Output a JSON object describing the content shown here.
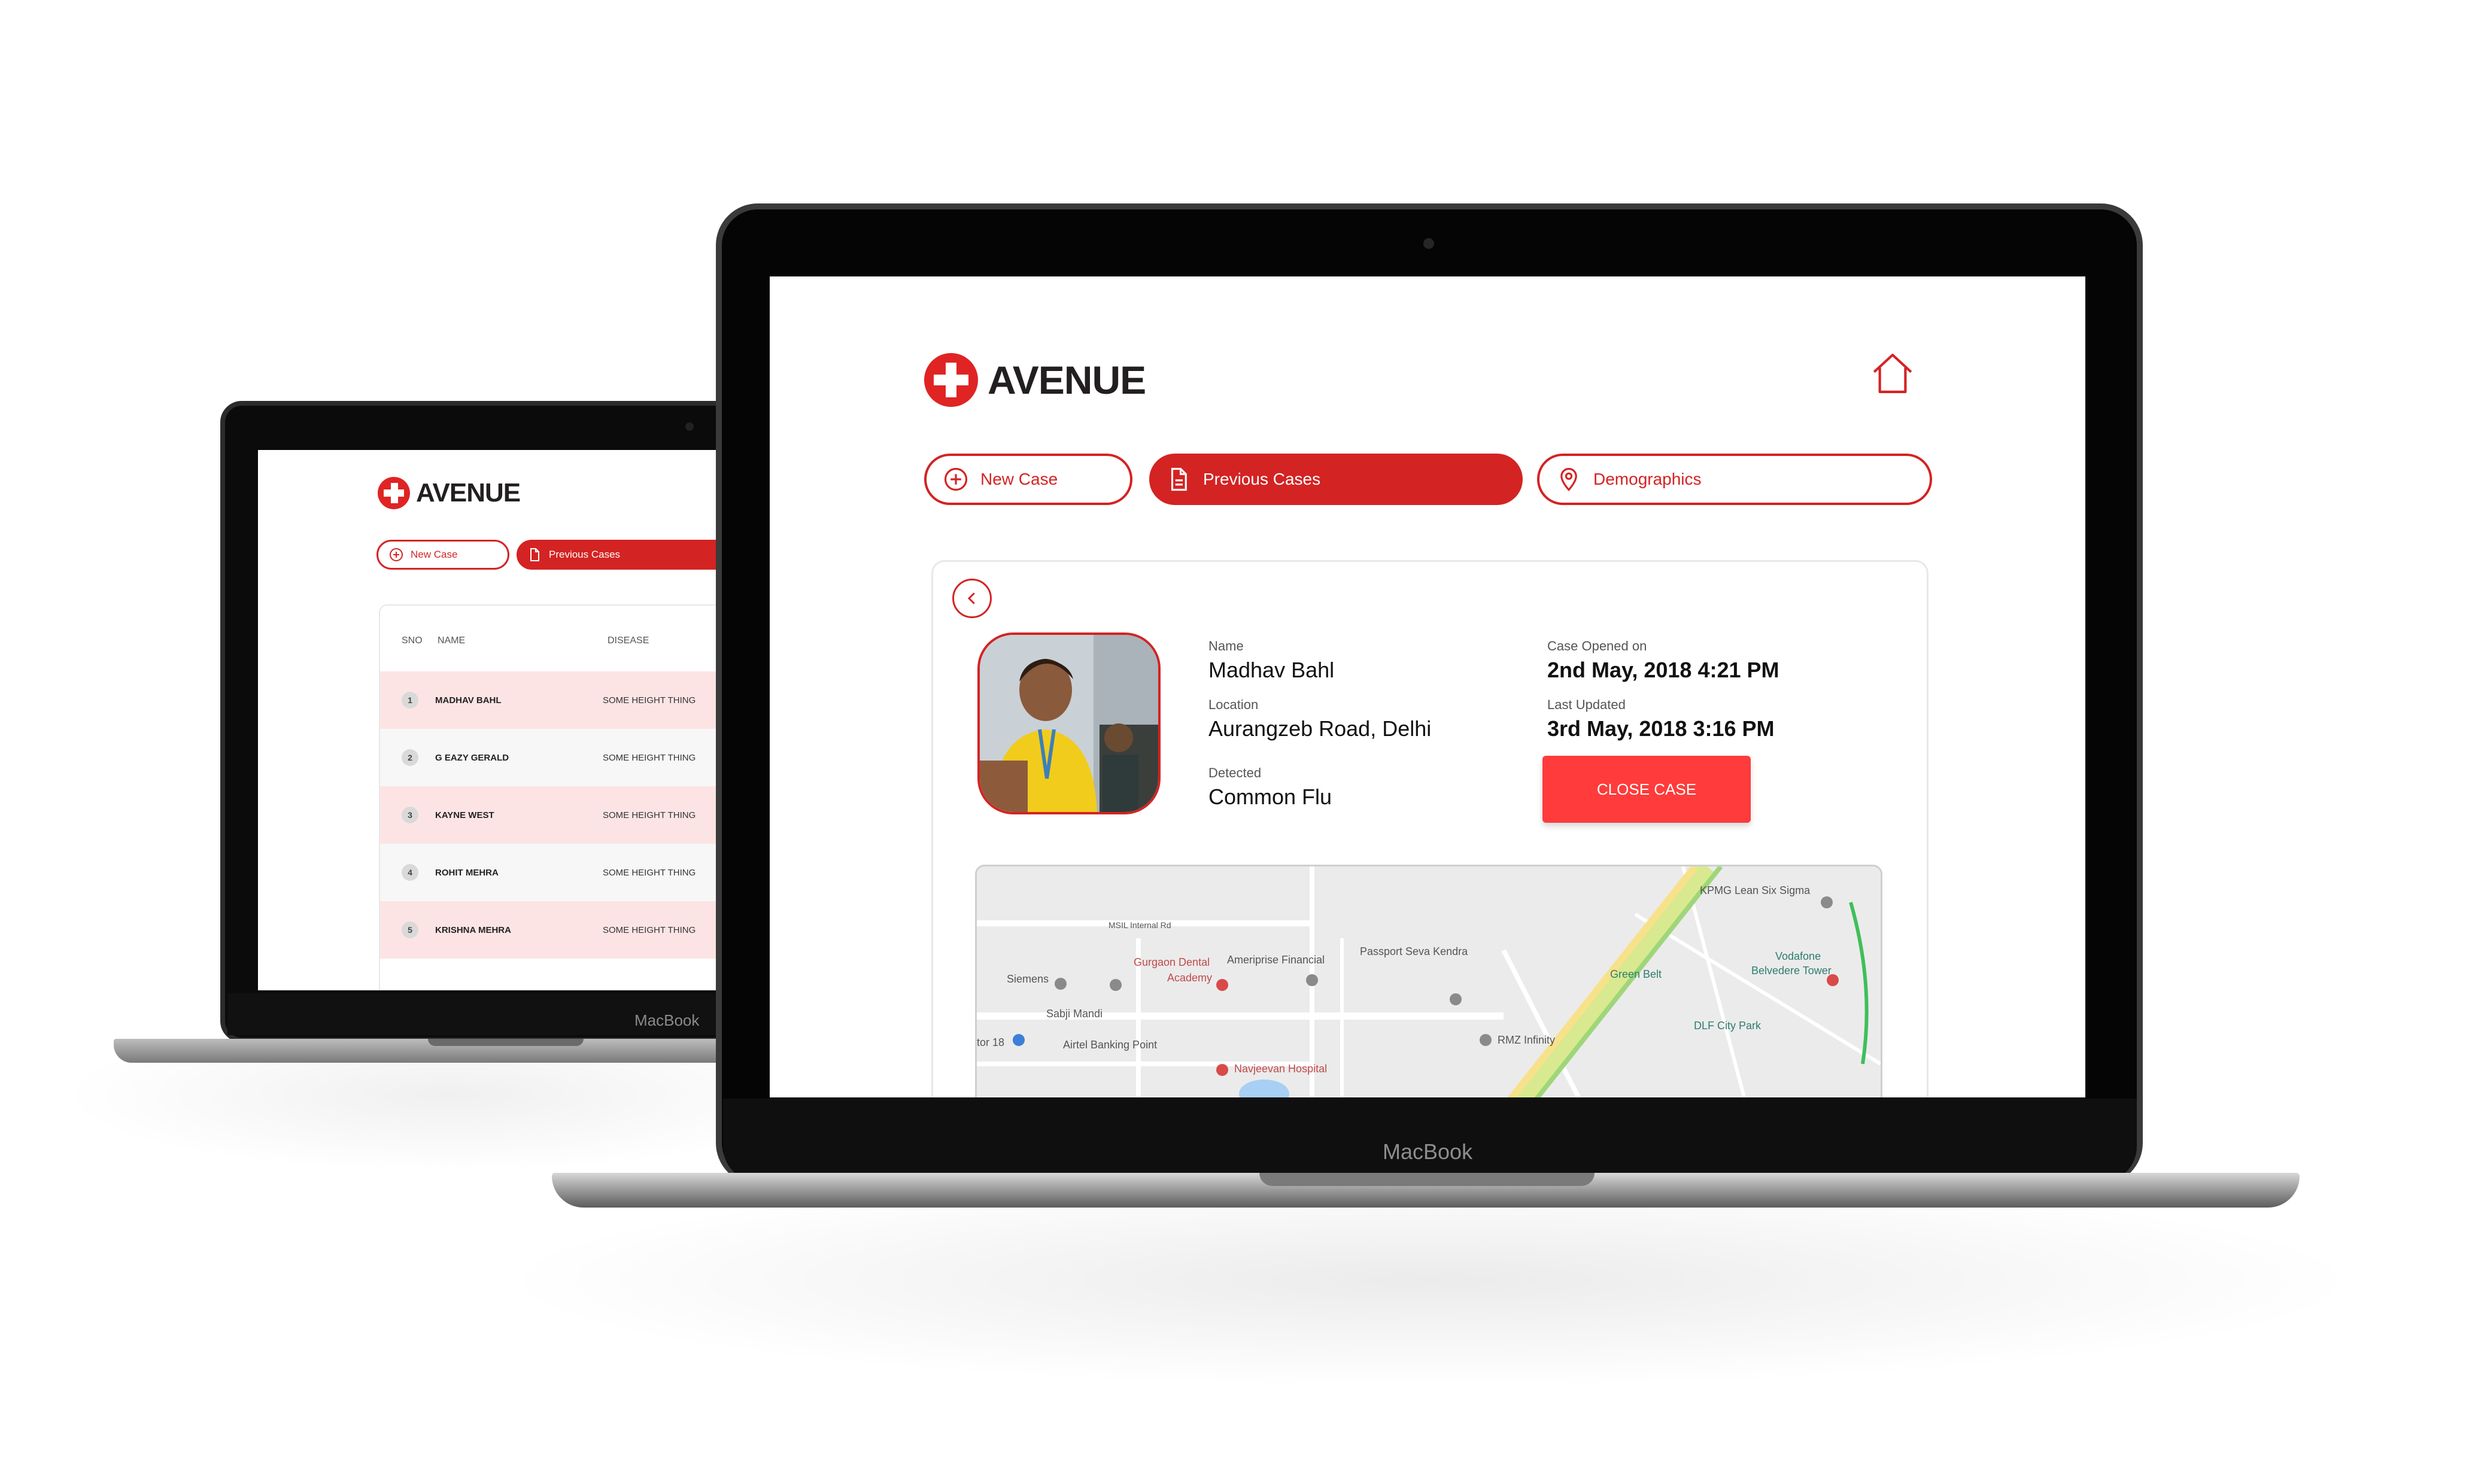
{
  "brand": {
    "name": "AVENUE",
    "device_label": "MacBook",
    "accent": "#d42323",
    "close_button_color": "#ff3b3b"
  },
  "nav": {
    "new_case": "New Case",
    "previous_cases": "Previous Cases",
    "demographics": "Demographics"
  },
  "back_screen": {
    "table": {
      "columns": [
        "SNO",
        "NAME",
        "DISEASE"
      ],
      "rows": [
        {
          "sno": "1",
          "name": "MADHAV BAHL",
          "disease": "SOME HEIGHT THING",
          "highlighted": true
        },
        {
          "sno": "2",
          "name": "G EAZY GERALD",
          "disease": "SOME HEIGHT THING",
          "highlighted": false
        },
        {
          "sno": "3",
          "name": "KAYNE WEST",
          "disease": "SOME HEIGHT THING",
          "highlighted": true
        },
        {
          "sno": "4",
          "name": "ROHIT MEHRA",
          "disease": "SOME HEIGHT THING",
          "highlighted": false
        },
        {
          "sno": "5",
          "name": "KRISHNA MEHRA",
          "disease": "SOME HEIGHT THING",
          "highlighted": true
        }
      ]
    }
  },
  "case": {
    "name_label": "Name",
    "name": "Madhav Bahl",
    "location_label": "Location",
    "location": "Aurangzeb Road, Delhi",
    "detected_label": "Detected",
    "detected": "Common Flu",
    "opened_label": "Case Opened on",
    "opened": "2nd May, 2018 4:21 PM",
    "updated_label": "Last Updated",
    "updated": "3rd May, 2018 3:16 PM",
    "close_button": "CLOSE CASE"
  },
  "map": {
    "labels": [
      "MSIL Internal Rd",
      "Gurgaon Dental",
      "Academy",
      "Ameriprise Financial",
      "Passport Seva Kendra",
      "Siemens",
      "Sabji Mandi",
      "Airtel Banking Point",
      "Navjeevan Hospital",
      "RMZ Infinity",
      "Green Belt",
      "KPMG Lean Six Sigma",
      "Vodafone",
      "Belvedere Tower",
      "DLF City Park",
      "tor 18",
      "ctor"
    ]
  }
}
